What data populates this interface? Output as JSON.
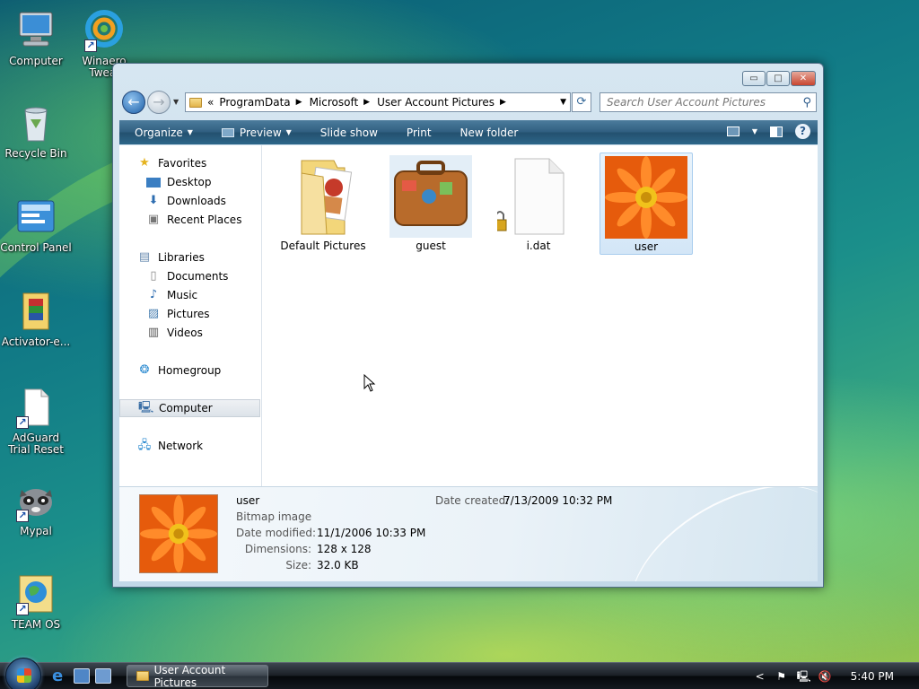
{
  "desktop": {
    "icons": [
      {
        "label": "Computer"
      },
      {
        "label": "Winaero Tweal"
      },
      {
        "label": "Recycle Bin"
      },
      {
        "label": "Control Panel"
      },
      {
        "label": "Activator-e..."
      },
      {
        "label": "AdGuard Trial Reset"
      },
      {
        "label": "Mypal"
      },
      {
        "label": "TEAM OS"
      }
    ]
  },
  "window": {
    "title": "User Account Pictures",
    "controls": {
      "minimize": "▭",
      "maximize": "□",
      "close": "✕"
    },
    "address": {
      "prefix": "«",
      "crumbs": [
        "ProgramData",
        "Microsoft",
        "User Account Pictures"
      ],
      "separator": "▶"
    },
    "search": {
      "placeholder": "Search User Account Pictures"
    },
    "toolbar": {
      "organize": "Organize",
      "preview": "Preview",
      "slideshow": "Slide show",
      "print": "Print",
      "new_folder": "New folder",
      "help": "?"
    },
    "nav": {
      "favorites": "Favorites",
      "desktop": "Desktop",
      "downloads": "Downloads",
      "recent_places": "Recent Places",
      "libraries": "Libraries",
      "documents": "Documents",
      "music": "Music",
      "pictures": "Pictures",
      "videos": "Videos",
      "homegroup": "Homegroup",
      "computer": "Computer",
      "network": "Network"
    },
    "files": [
      {
        "name": "Default Pictures",
        "type": "folder"
      },
      {
        "name": "guest",
        "type": "image"
      },
      {
        "name": "i.dat",
        "type": "file-locked"
      },
      {
        "name": "user",
        "type": "image",
        "selected": true
      }
    ],
    "details": {
      "name": "user",
      "type": "Bitmap image",
      "date_modified_label": "Date modified:",
      "date_modified": "11/1/2006 10:33 PM",
      "dimensions_label": "Dimensions:",
      "dimensions": "128 x 128",
      "size_label": "Size:",
      "size": "32.0 KB",
      "date_created_label": "Date created:",
      "date_created": "7/13/2009 10:32 PM"
    }
  },
  "taskbar": {
    "task_label": "User Account Pictures",
    "clock": "5:40 PM",
    "tray_expand": "<"
  },
  "colors": {
    "toolbar": "#2f5e80",
    "selection": "#d3e6f7",
    "flower_orange": "#f06a10"
  }
}
